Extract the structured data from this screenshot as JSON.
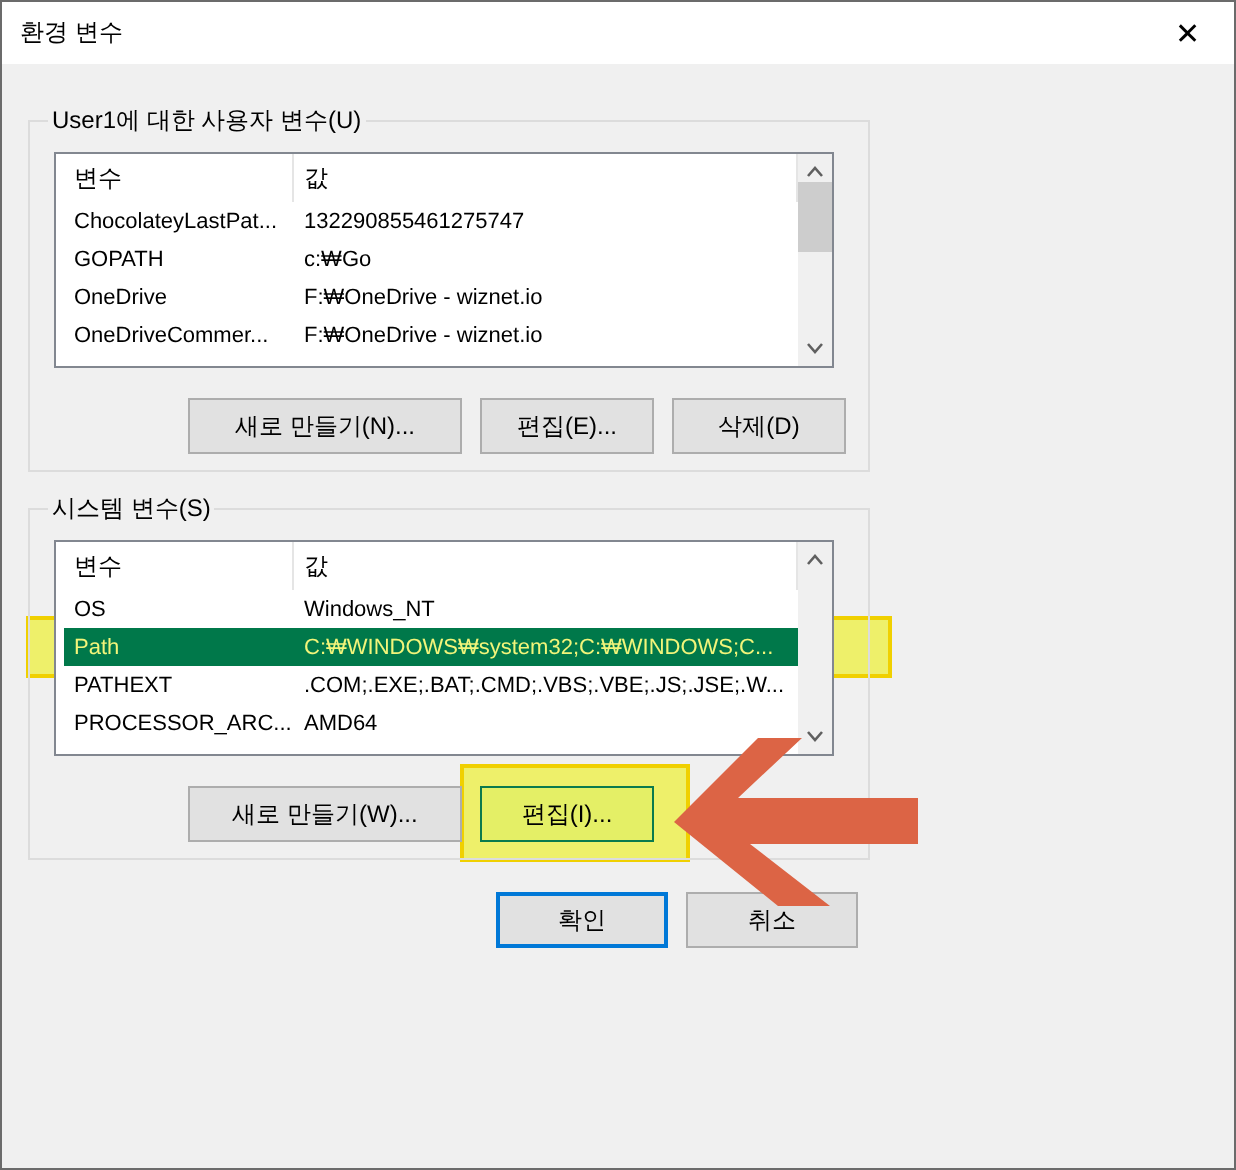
{
  "window": {
    "title": "환경 변수",
    "close": "✕"
  },
  "user_variables": {
    "title": "User1에 대한 사용자 변수(U)",
    "columns": [
      "변수",
      "값"
    ],
    "rows": [
      {
        "name": "ChocolateyLastPat...",
        "value": "132290855461275747",
        "selected": false,
        "highlighted": false
      },
      {
        "name": "GOPATH",
        "value": "c:₩Go",
        "selected": false,
        "highlighted": false
      },
      {
        "name": "OneDrive",
        "value": "F:₩OneDrive - wiznet.io",
        "selected": false,
        "highlighted": false
      },
      {
        "name": "OneDriveCommer...",
        "value": "F:₩OneDrive - wiznet.io",
        "selected": false,
        "highlighted": false
      }
    ],
    "buttons": [
      {
        "label": "새로 만들기(N)...",
        "highlighted": false
      },
      {
        "label": "편집(E)...",
        "highlighted": false
      },
      {
        "label": "삭제(D)",
        "highlighted": false
      }
    ]
  },
  "system_variables": {
    "title": "시스템 변수(S)",
    "columns": [
      "변수",
      "값"
    ],
    "rows": [
      {
        "name": "OS",
        "value": "Windows_NT",
        "selected": false,
        "highlighted": false
      },
      {
        "name": "Path",
        "value": "C:₩WINDOWS₩system32;C:₩WINDOWS;C...",
        "selected": true,
        "highlighted": true
      },
      {
        "name": "PATHEXT",
        "value": ".COM;.EXE;.BAT;.CMD;.VBS;.VBE;.JS;.JSE;.W...",
        "selected": false,
        "highlighted": false
      },
      {
        "name": "PROCESSOR_ARC...",
        "value": "AMD64",
        "selected": false,
        "highlighted": false
      }
    ],
    "buttons": [
      {
        "label": "새로 만들기(W)...",
        "highlighted": false
      },
      {
        "label": "편집(I)...",
        "highlighted": true
      }
    ]
  },
  "dialog_buttons": [
    {
      "label": "확인",
      "default": true
    },
    {
      "label": "취소",
      "default": false
    }
  ]
}
